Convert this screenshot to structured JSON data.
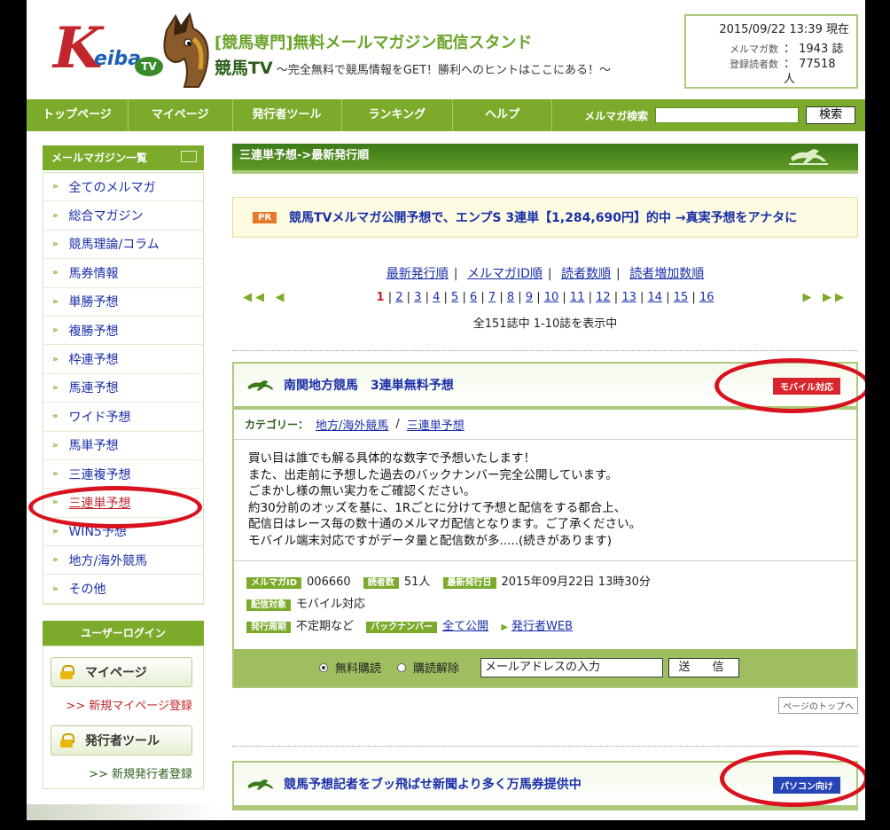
{
  "header": {
    "logo_k": "K",
    "logo_eiba": "eiba",
    "logo_tv": "TV",
    "tagline1": "[競馬専門]無料メールマガジン配信スタンド",
    "brand": "競馬TV",
    "tagline2": "～完全無料で競馬情報をGET！勝利へのヒントはここにある！～",
    "datetime": "2015/09/22 13:39  現在",
    "mag_count_label": "メルマガ数",
    "mag_count": "：  1943 誌",
    "reader_label": "登録読者数",
    "reader_count": "：  77518 人"
  },
  "nav": {
    "items": [
      "トップページ",
      "マイページ",
      "発行者ツール",
      "ランキング",
      "ヘルプ"
    ],
    "search_label": "メルマガ検索",
    "search_button": "検索"
  },
  "sidebar": {
    "title": "メールマガジン一覧",
    "items": [
      "全てのメルマガ",
      "総合マガジン",
      "競馬理論/コラム",
      "馬券情報",
      "単勝予想",
      "複勝予想",
      "枠連予想",
      "馬連予想",
      "ワイド予想",
      "馬単予想",
      "三連複予想",
      "三連単予想",
      "WIN5予想",
      "地方/海外競馬",
      "その他"
    ],
    "login_title": "ユーザーログイン",
    "mypage_button": "マイページ",
    "mypage_register": ">> 新規マイページ登録",
    "publisher_button": "発行者ツール",
    "publisher_register": ">> 新規発行者登録"
  },
  "main": {
    "heading": "三連単予想->最新発行順",
    "pr_badge": "PR",
    "pr_text": "競馬TVメルマガ公開予想で、エンプS 3連単【1,284,690円】的中 →真実予想をアナタに",
    "sort": [
      "最新発行順",
      "メルマガID順",
      "読者数順",
      "読者増加数順"
    ],
    "sort_sep": "|",
    "pages": [
      "2",
      "3",
      "4",
      "5",
      "6",
      "7",
      "8",
      "9",
      "10",
      "11",
      "12",
      "13",
      "14",
      "15",
      "16"
    ],
    "current_page": "1",
    "prev": "◀◀ ◀",
    "next": "▶ ▶▶",
    "count": "全151誌中 1-10誌を表示中",
    "totop": "ページのトップへ"
  },
  "card1": {
    "title": "南関地方競馬　3連単無料予想",
    "badge": "モバイル対応",
    "cat_label": "カテゴリー：",
    "cat1": "地方/海外競馬",
    "cat_sep": "/",
    "cat2": "三連単予想",
    "desc": [
      "買い目は誰でも解る具体的な数字で予想いたします！",
      "また、出走前に予想した過去のバックナンバー完全公開しています。",
      "ごまかし様の無い実力をご確認ください。",
      "約30分前のオッズを基に、1Rごとに分けて予想と配信をする都合上、",
      "配信日はレース毎の数十通のメルマガ配信となります。ご了承ください。",
      "モバイル端末対応ですがデータ量と配信数が多.....(続きがあります)"
    ],
    "tag_id": "メルマガID",
    "id": "006660",
    "tag_readers": "読者数",
    "readers": "51人",
    "tag_latest": "最新発行日",
    "latest": "2015年09月22日 13時30分",
    "tag_target": "配信対象",
    "target": "モバイル対応",
    "tag_cycle": "発行周期",
    "cycle": "不定期など",
    "tag_backnumber": "バックナンバー",
    "backnumber": "全て公開",
    "publisher_web": "発行者WEB",
    "radio_subscribe": "無料購読",
    "radio_unsubscribe": "購読解除",
    "email_placeholder": "メールアドレスの入力",
    "send": "送　信"
  },
  "card2": {
    "title": "競馬予想記者をブッ飛ばせ新聞より多く万馬券提供中",
    "badge": "パソコン向け"
  }
}
